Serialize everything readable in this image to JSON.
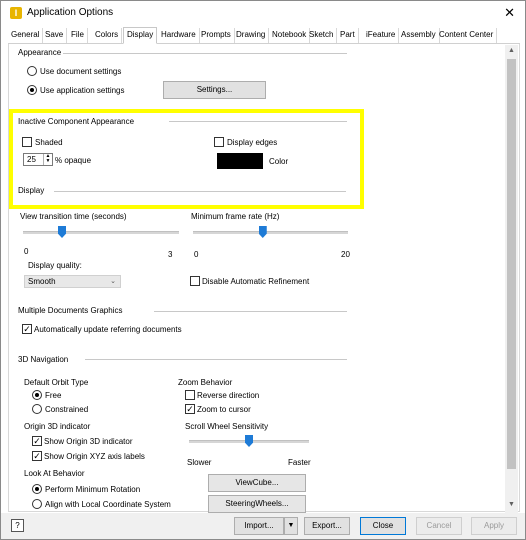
{
  "window": {
    "title": "Application Options",
    "close_glyph": "✕",
    "app_icon_glyph": "I"
  },
  "tabs": [
    {
      "label": "General"
    },
    {
      "label": "Save"
    },
    {
      "label": "File"
    },
    {
      "label": "Colors"
    },
    {
      "label": "Display",
      "active": true
    },
    {
      "label": "Hardware"
    },
    {
      "label": "Prompts"
    },
    {
      "label": "Drawing"
    },
    {
      "label": "Notebook"
    },
    {
      "label": "Sketch"
    },
    {
      "label": "Part"
    },
    {
      "label": "iFeature"
    },
    {
      "label": "Assembly"
    },
    {
      "label": "Content Center"
    }
  ],
  "appearance": {
    "heading": "Appearance",
    "use_document": "Use document settings",
    "use_application": "Use application settings",
    "selected": "application",
    "settings_button": "Settings..."
  },
  "inactive": {
    "heading": "Inactive Component Appearance",
    "shaded_label": "Shaded",
    "shaded_checked": false,
    "display_edges_label": "Display edges",
    "display_edges_checked": false,
    "opacity_value": "25",
    "opacity_label": "% opaque",
    "color_label": "Color",
    "color_value": "#000000",
    "highlight_color": "#ffff00"
  },
  "display": {
    "heading": "Display",
    "view_transition_label": "View transition time (seconds)",
    "view_transition_min": "0",
    "view_transition_max": "3",
    "view_transition_value_fraction": 0.25,
    "min_frame_rate_label": "Minimum frame rate (Hz)",
    "min_frame_rate_min": "0",
    "min_frame_rate_max": "20",
    "min_frame_rate_value_fraction": 0.45,
    "display_quality_label": "Display quality:",
    "display_quality_value": "Smooth",
    "disable_refinement_label": "Disable Automatic Refinement",
    "disable_refinement_checked": false
  },
  "multidoc": {
    "heading": "Multiple Documents Graphics",
    "auto_update_label": "Automatically update referring documents",
    "auto_update_checked": true
  },
  "nav3d": {
    "heading": "3D Navigation",
    "orbit_type_label": "Default Orbit Type",
    "orbit_free": "Free",
    "orbit_constrained": "Constrained",
    "orbit_selected": "free",
    "origin_label": "Origin 3D indicator",
    "show_origin_label": "Show Origin 3D indicator",
    "show_origin_checked": true,
    "show_xyz_label": "Show Origin XYZ axis labels",
    "show_xyz_checked": true,
    "look_at_label": "Look At Behavior",
    "perform_min_rotation": "Perform Minimum Rotation",
    "align_local": "Align with Local Coordinate System",
    "look_at_selected": "minimum",
    "zoom_behavior_label": "Zoom Behavior",
    "reverse_direction_label": "Reverse direction",
    "reverse_direction_checked": false,
    "zoom_to_cursor_label": "Zoom to cursor",
    "zoom_to_cursor_checked": true,
    "scroll_sensitivity_label": "Scroll Wheel Sensitivity",
    "scroll_slower": "Slower",
    "scroll_faster": "Faster",
    "scroll_value_fraction": 0.5,
    "viewcube_button": "ViewCube...",
    "steeringwheels_button": "SteeringWheels..."
  },
  "footer": {
    "help_glyph": "?",
    "import_button": "Import...",
    "import_dropdown_glyph": "▼",
    "export_button": "Export...",
    "close_button": "Close",
    "cancel_button": "Cancel",
    "apply_button": "Apply"
  },
  "scrollbar": {
    "up_glyph": "▲",
    "down_glyph": "▼"
  }
}
